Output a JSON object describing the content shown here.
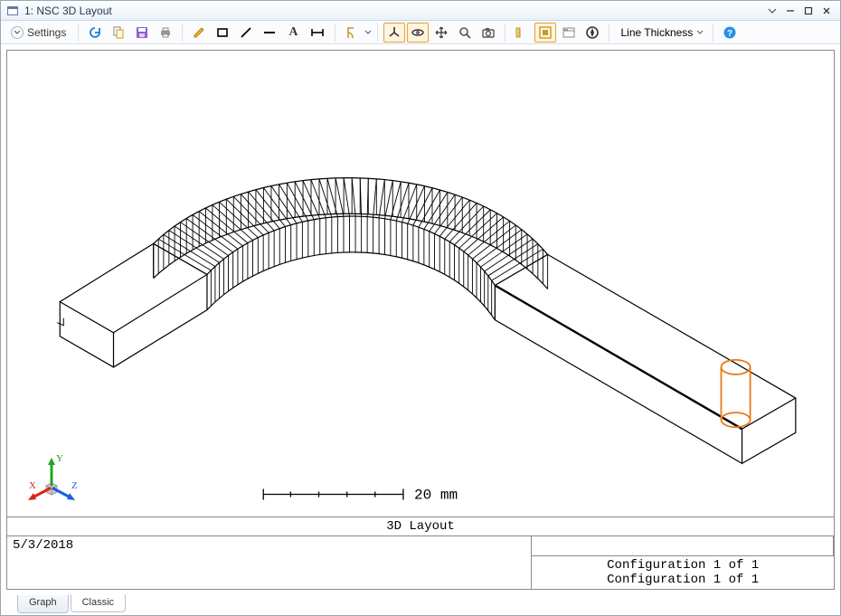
{
  "window": {
    "title": "1: NSC 3D Layout"
  },
  "toolbar": {
    "settings_label": "Settings",
    "line_thickness_label": "Line Thickness",
    "icons": {
      "refresh": "refresh-icon",
      "copy": "copy-icon",
      "save": "save-icon",
      "print": "print-icon",
      "pencil": "pencil-icon",
      "rectangle": "rectangle-icon",
      "line_diag": "line-diag-icon",
      "line_horiz": "line-horiz-icon",
      "text_a": "text-icon",
      "dimension": "dimension-icon",
      "caliper": "caliper-icon",
      "axes_toggle": "axes-icon",
      "orbit": "orbit-icon",
      "pan": "pan-icon",
      "zoom": "zoom-icon",
      "camera": "camera-icon",
      "ruler": "ruler-icon",
      "fit": "fit-icon",
      "layers": "layers-icon",
      "compass": "compass-icon",
      "help": "help-icon"
    }
  },
  "view": {
    "title": "3D Layout",
    "date": "5/3/2018",
    "scale_label": "20 mm",
    "config_line1": "Configuration 1 of 1",
    "config_line2": "Configuration 1 of 1",
    "axes": {
      "x": "X",
      "y": "Y",
      "z": "Z"
    }
  },
  "tabs": {
    "graph": "Graph",
    "classic": "Classic"
  },
  "colors": {
    "accent_orange": "#e87b1a",
    "wire": "#000000"
  }
}
